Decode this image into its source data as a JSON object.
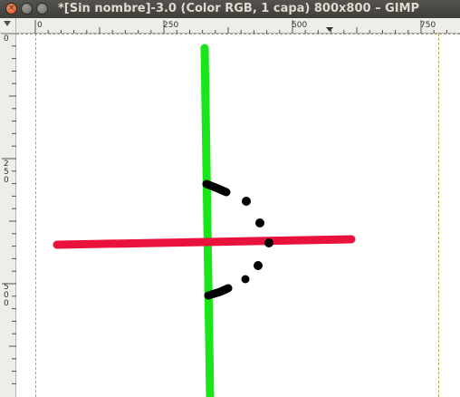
{
  "window": {
    "title": "*[Sin nombre]-3.0 (Color RGB, 1 capa) 800x800 – GIMP",
    "close_glyph": "×"
  },
  "rulers": {
    "horizontal_labels": [
      "0",
      "250",
      "500",
      "750"
    ],
    "vertical_labels": [
      [
        "0"
      ],
      [
        "2",
        "5",
        "0"
      ],
      [
        "5",
        "0",
        "0"
      ]
    ]
  },
  "colors": {
    "green_line": "#19e619",
    "red_line": "#e8123c",
    "black_strokes": "#000000",
    "canvas": "#ffffff"
  },
  "icons": [
    "close-icon",
    "minimize-icon",
    "maximize-icon",
    "navigate-icon"
  ]
}
